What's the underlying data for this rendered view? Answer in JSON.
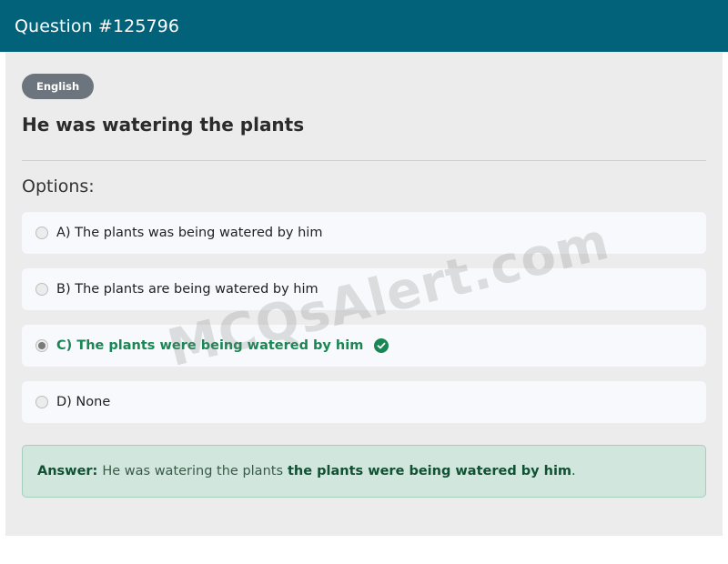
{
  "header": {
    "title": "Question #125796"
  },
  "question": {
    "category": "English",
    "text": "He was watering the plants",
    "options_heading": "Options:",
    "options": [
      {
        "label": "A) The plants was being watered by him",
        "selected": false,
        "correct": false
      },
      {
        "label": "B) The plants are being watered by him",
        "selected": false,
        "correct": false
      },
      {
        "label": "C) The plants were being watered by him",
        "selected": true,
        "correct": true
      },
      {
        "label": "D) None",
        "selected": false,
        "correct": false
      }
    ]
  },
  "answer": {
    "label": "Answer:",
    "question_text": "He was watering the plants",
    "correct_text": "the plants were being watered by him",
    "suffix": "."
  },
  "watermark": "MCQsAlert.com",
  "colors": {
    "header_bg": "#02627a",
    "correct": "#198754",
    "answer_bg": "#d1e7dd",
    "badge_bg": "#6c757d"
  },
  "icons": {
    "correct_option": "check-circle-icon"
  }
}
